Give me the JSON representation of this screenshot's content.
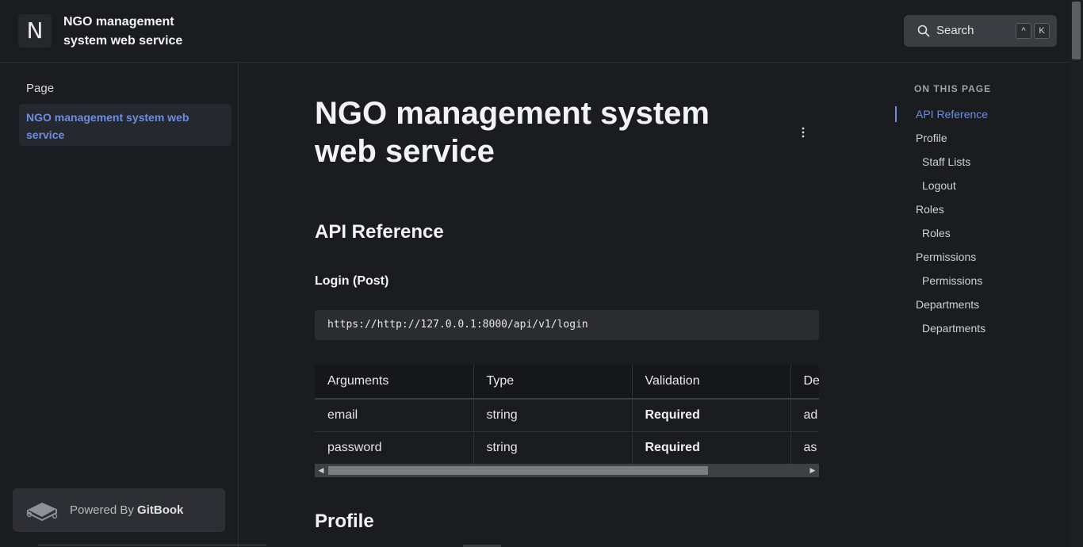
{
  "header": {
    "logo_letter": "N",
    "site_title": "NGO management system web service",
    "search_label": "Search",
    "shortcut_keys": [
      "^",
      "K"
    ]
  },
  "sidebar": {
    "heading": "Page",
    "items": [
      {
        "label": "NGO management system web service",
        "active": true
      }
    ],
    "powered_by": {
      "prefix": "Powered By",
      "brand": "GitBook"
    }
  },
  "main": {
    "title": "NGO management system web service",
    "section_title": "API Reference",
    "subsection_title": "Login (Post)",
    "code": "https://http://127.0.0.1:8000/api/v1/login",
    "table": {
      "headers": [
        "Arguments",
        "Type",
        "Validation",
        "De"
      ],
      "rows": [
        [
          "email",
          "string",
          "Required",
          "ad"
        ],
        [
          "password",
          "string",
          "Required",
          "as"
        ]
      ]
    },
    "next_section_title": "Profile"
  },
  "toc": {
    "heading": "ON THIS PAGE",
    "items": [
      {
        "label": "API Reference",
        "level": 1,
        "active": true
      },
      {
        "label": "Profile",
        "level": 1,
        "active": false
      },
      {
        "label": "Staff Lists",
        "level": 2,
        "active": false
      },
      {
        "label": "Logout",
        "level": 2,
        "active": false
      },
      {
        "label": "Roles",
        "level": 1,
        "active": false
      },
      {
        "label": "Roles",
        "level": 2,
        "active": false
      },
      {
        "label": "Permissions",
        "level": 1,
        "active": false
      },
      {
        "label": "Permissions",
        "level": 2,
        "active": false
      },
      {
        "label": "Departments",
        "level": 1,
        "active": false
      },
      {
        "label": "Departments",
        "level": 2,
        "active": false
      }
    ]
  },
  "colors": {
    "background": "#1b1c1f",
    "accent": "#6b8fe0"
  }
}
